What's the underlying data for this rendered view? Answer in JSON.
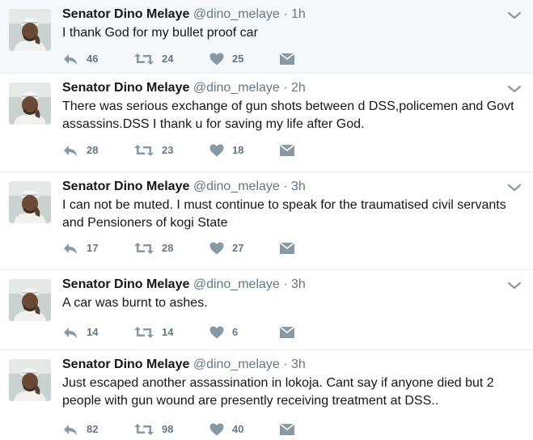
{
  "colors": {
    "icon_gray": "#8899a6",
    "name_text": "#14171a",
    "meta_text": "#657786",
    "divider": "#e6ecf0",
    "first_row_bg": "#f5f8fa"
  },
  "icons": {
    "reply": "reply-icon",
    "retweet": "retweet-icon",
    "like": "heart-icon",
    "dm": "envelope-icon",
    "more": "chevron-down-icon"
  },
  "tweets": [
    {
      "name": "Senator Dino Melaye",
      "handle": "@dino_melaye",
      "dot": "·",
      "time": "1h",
      "text": "I thank God for my bullet proof car",
      "replies": "46",
      "retweets": "24",
      "likes": "25"
    },
    {
      "name": "Senator Dino Melaye",
      "handle": "@dino_melaye",
      "dot": "·",
      "time": "2h",
      "text": "There was serious exchange of gun shots between d DSS,policemen and Govt assassins.DSS I thank u for saving my life after God.",
      "replies": "28",
      "retweets": "23",
      "likes": "18"
    },
    {
      "name": "Senator Dino Melaye",
      "handle": "@dino_melaye",
      "dot": "·",
      "time": "3h",
      "text": "I can not be muted. I must continue to speak for the traumatised civil servants and Pensioners of kogi State",
      "replies": "17",
      "retweets": "28",
      "likes": "27"
    },
    {
      "name": "Senator Dino Melaye",
      "handle": "@dino_melaye",
      "dot": "·",
      "time": "3h",
      "text": "A car was burnt to ashes.",
      "replies": "14",
      "retweets": "14",
      "likes": "6"
    },
    {
      "name": "Senator Dino Melaye",
      "handle": "@dino_melaye",
      "dot": "·",
      "time": "3h",
      "text": "Just escaped another assassination in lokoja. Cant say if anyone died but 2 people with gun wound are presently receiving treatment at DSS..",
      "replies": "82",
      "retweets": "98",
      "likes": "40"
    }
  ]
}
